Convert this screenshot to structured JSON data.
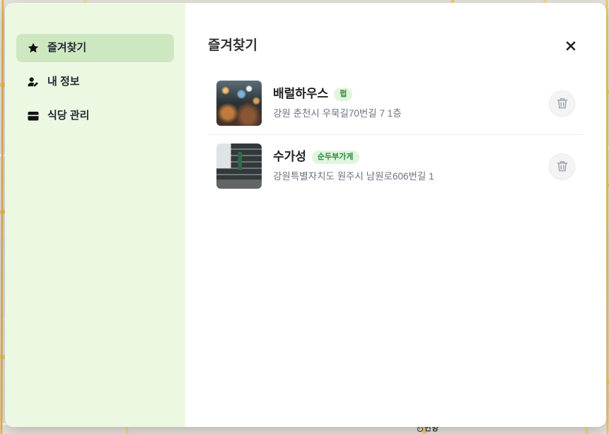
{
  "sidebar": {
    "items": [
      {
        "label": "즐겨찾기",
        "icon": "star-icon",
        "active": true
      },
      {
        "label": "내 정보",
        "icon": "user-pen-icon",
        "active": false
      },
      {
        "label": "식당 관리",
        "icon": "store-icon",
        "active": false
      }
    ]
  },
  "main": {
    "title": "즐겨찾기",
    "close_icon": "close-icon",
    "delete_icon": "trash-icon",
    "favorites": [
      {
        "name": "배럴하우스",
        "category": "펍",
        "address": "강원 춘천시 우묵길70번길 7 1층"
      },
      {
        "name": "수가성",
        "category": "순두부가게",
        "address": "강원특별자치도 원주시 남원로606번길 1"
      }
    ]
  },
  "map": {
    "place_label": "안양"
  },
  "colors": {
    "sidebar_background": "#edf8e3",
    "active_item_background": "#cde8c0",
    "badge_background": "#e2f5df",
    "badge_text": "#2b8a3e",
    "address_text": "#6b7280",
    "delete_icon": "#9ca3af",
    "map_road": "#f2cf6f"
  }
}
